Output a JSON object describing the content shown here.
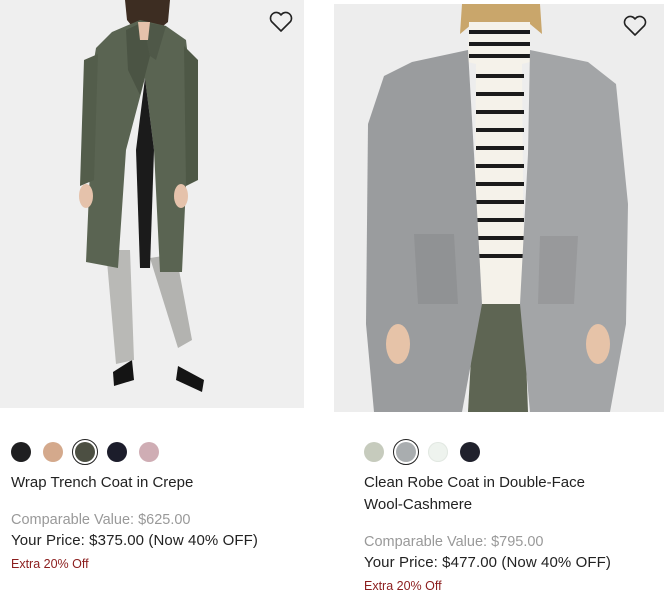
{
  "products": [
    {
      "name": "Wrap Trench Coat in Crepe",
      "comparable": "Comparable Value: $625.00",
      "your_price": "Your Price: $375.00 (Now 40% OFF)",
      "extra": "Extra 20% Off",
      "swatches": [
        "#1f1f21",
        "#d4a98c",
        "#4c4f42",
        "#1c1d2b",
        "#cfadb4"
      ],
      "selected_swatch": 2,
      "colors": {
        "coat": "#5a6452",
        "pants": "#b9b9b6",
        "background": "#efefef"
      }
    },
    {
      "name": "Clean Robe Coat in Double-Face Wool-Cashmere",
      "comparable": "Comparable Value: $795.00",
      "your_price": "Your Price: $477.00 (Now 40% OFF)",
      "extra": "Extra 20% Off",
      "swatches": [
        "#c6cbbd",
        "#a9adaf",
        "#eef3ee",
        "#20212c"
      ],
      "selected_swatch": 1,
      "colors": {
        "coat": "#9a9c9e",
        "pants": "#5e6553",
        "background": "#ededed"
      }
    }
  ],
  "icons": {
    "wishlist": "heart-outline-icon"
  },
  "accent": {
    "extra_text": "#8b1d1d",
    "muted_text": "#999999"
  }
}
